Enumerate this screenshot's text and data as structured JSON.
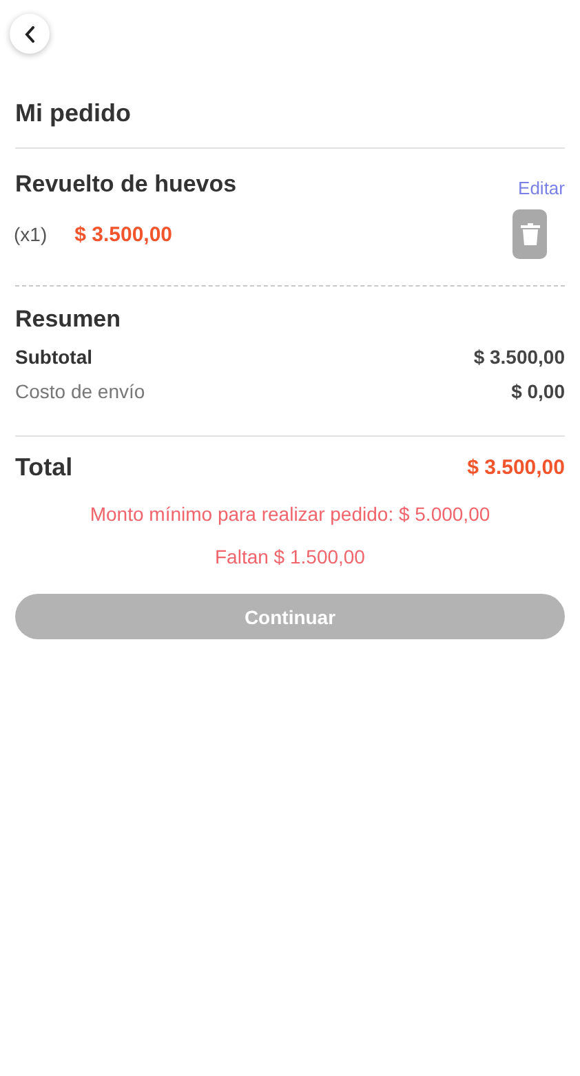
{
  "header": {
    "title": "Mi pedido"
  },
  "items": [
    {
      "name": "Revuelto de huevos",
      "edit": "Editar",
      "quantity": "(x1)",
      "price": "$ 3.500,00"
    }
  ],
  "summary": {
    "title": "Resumen",
    "rows": [
      {
        "kind": "strong",
        "label": "Subtotal",
        "value": "$ 3.500,00"
      },
      {
        "kind": "muted",
        "label": "Costo de envío",
        "value": "$ 0,00"
      }
    ],
    "total_label": "Total",
    "total_value": "$ 3.500,00"
  },
  "warnings": [
    "Monto mínimo para realizar pedido: $ 5.000,00",
    "Faltan $ 1.500,00"
  ],
  "continue_button": {
    "label": "Continuar",
    "disabled": true
  }
}
